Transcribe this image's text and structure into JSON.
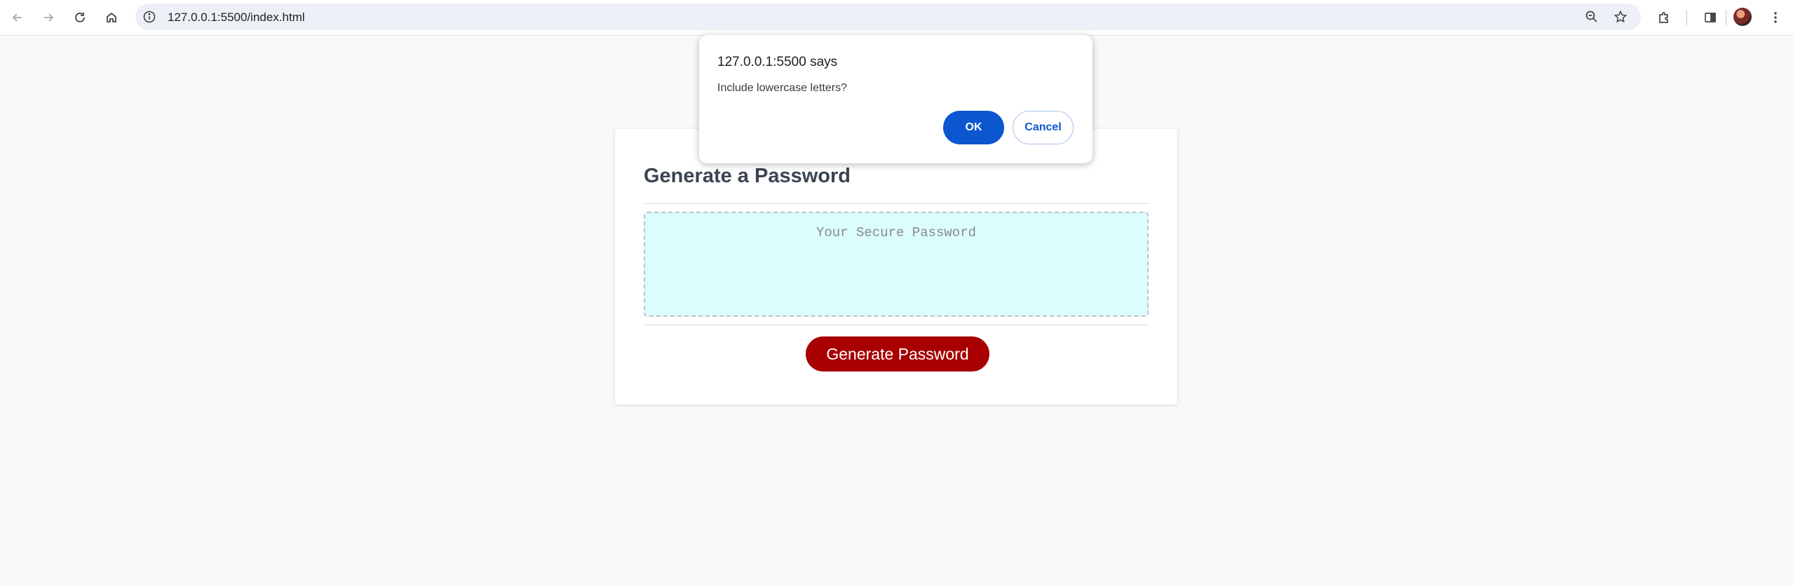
{
  "browser": {
    "url": "127.0.0.1:5500/index.html",
    "icons": [
      "back-icon",
      "forward-icon",
      "reload-icon",
      "home-icon",
      "site-info-icon",
      "zoom-icon",
      "bookmark-star-icon",
      "extensions-icon",
      "side-panel-icon",
      "profile-avatar",
      "menu-icon"
    ]
  },
  "page": {
    "title": "Generate a Password",
    "password_placeholder": "Your Secure Password",
    "generate_button_label": "Generate Password",
    "accent_color": "#a80000",
    "password_box_color": "#dcfdfd"
  },
  "dialog": {
    "title": "127.0.0.1:5500 says",
    "message": "Include lowercase letters?",
    "ok_label": "OK",
    "cancel_label": "Cancel",
    "primary_color": "#0b57d0"
  }
}
